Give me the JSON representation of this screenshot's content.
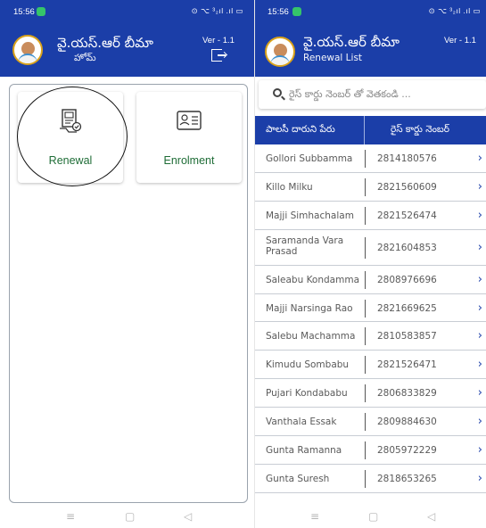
{
  "left": {
    "status": {
      "time": "15:56",
      "icons": "⊙ ⌥ ³₂ıl .ıl ▭"
    },
    "app_title": "వై.యస్.ఆర్ బీమా",
    "subtitle": "హోమ్",
    "version": "Ver - 1.1",
    "cards": [
      {
        "label": "Renewal",
        "icon": "renewal-document-icon",
        "highlighted": true
      },
      {
        "label": "Enrolment",
        "icon": "id-card-icon",
        "highlighted": false
      }
    ]
  },
  "right": {
    "status": {
      "time": "15:56",
      "icons": "⊙ ⌥ ³₂ıl .ıl ▭"
    },
    "app_title": "వై.యస్.ఆర్ బీమా",
    "subtitle": "Renewal List",
    "version": "Ver - 1.1",
    "search_placeholder": "రైస్ కార్డు నెంబర్ తో వెతకండి ...",
    "table": {
      "headers": [
        "పాలసీ దారుని పేరు",
        "రైస్ కార్డు నెంబర్"
      ],
      "rows": [
        {
          "name": "Gollori Subbamma",
          "card": "2814180576"
        },
        {
          "name": "Killo Milku",
          "card": "2821560609"
        },
        {
          "name": "Majji Simhachalam",
          "card": "2821526474"
        },
        {
          "name": "Saramanda Vara Prasad",
          "card": "2821604853"
        },
        {
          "name": "Saleabu Kondamma",
          "card": "2808976696"
        },
        {
          "name": "Majji Narsinga Rao",
          "card": "2821669625"
        },
        {
          "name": "Salebu Machamma",
          "card": "2810583857"
        },
        {
          "name": "Kimudu Sombabu",
          "card": "2821526471"
        },
        {
          "name": "Pujari Kondababu",
          "card": "2806833829"
        },
        {
          "name": "Vanthala Essak",
          "card": "2809884630"
        },
        {
          "name": "Gunta Ramanna",
          "card": "2805972229"
        },
        {
          "name": "Gunta Suresh",
          "card": "2818653265"
        }
      ]
    }
  },
  "nav": {
    "recents": "≡",
    "home": "▢",
    "back": "◁"
  },
  "colors": {
    "primary": "#1b3ea8",
    "card_label": "#1f6d37",
    "status_dot": "#35c46a"
  }
}
